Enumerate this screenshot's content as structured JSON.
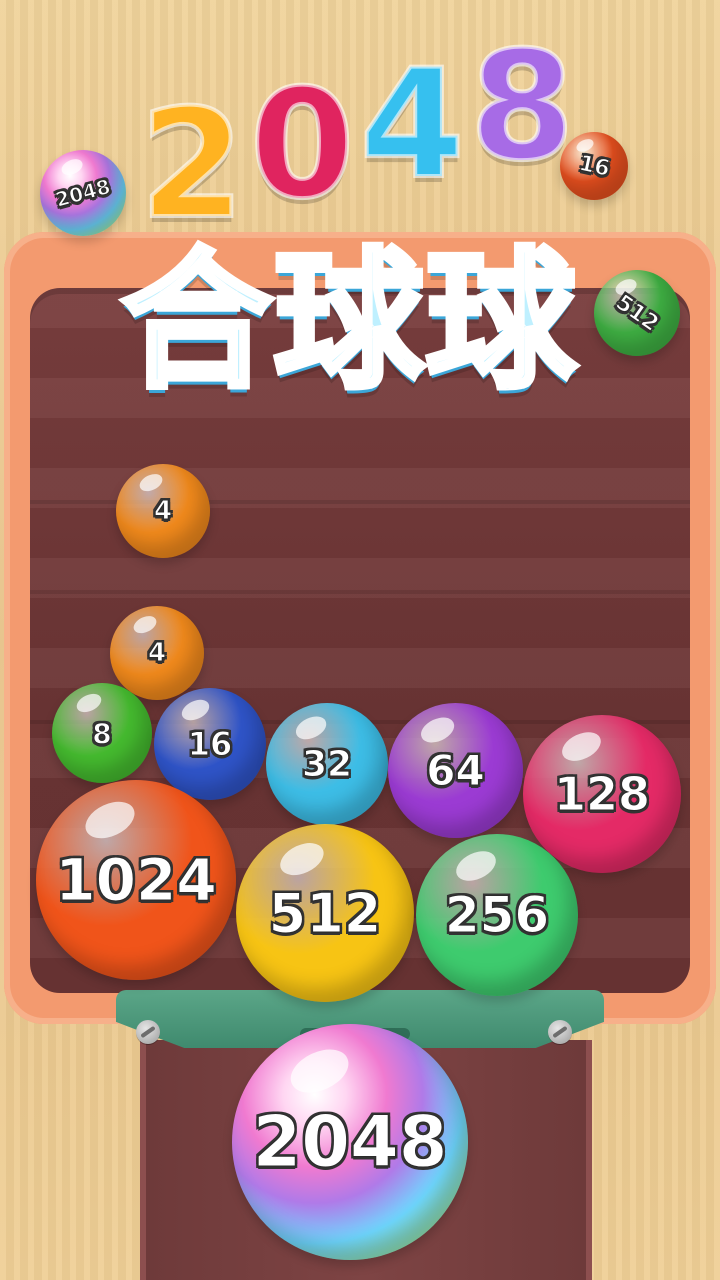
{
  "title": {
    "digits": [
      "2",
      "0",
      "4",
      "8"
    ],
    "digit_colors": [
      "#ffb321",
      "#e0245f",
      "#36c0ef",
      "#a76be6"
    ],
    "subtitle": "合球球"
  },
  "logo_balls": [
    {
      "value": "2048",
      "color": "rainbow"
    },
    {
      "value": "16",
      "color": "#e8501f"
    },
    {
      "value": "512",
      "color": "#3fb043"
    }
  ],
  "board_balls": [
    {
      "value": "4",
      "color": "#f28a1c"
    },
    {
      "value": "4",
      "color": "#f28a1c"
    },
    {
      "value": "8",
      "color": "#45bb2f"
    },
    {
      "value": "16",
      "color": "#2f54c8"
    },
    {
      "value": "32",
      "color": "#3dbde6"
    },
    {
      "value": "64",
      "color": "#9b3bd3"
    },
    {
      "value": "128",
      "color": "#e42a66"
    },
    {
      "value": "1024",
      "color": "#f0541a"
    },
    {
      "value": "512",
      "color": "#f7c414"
    },
    {
      "value": "256",
      "color": "#3ecb6e"
    }
  ],
  "next_ball": {
    "value": "2048",
    "color": "rainbow"
  }
}
